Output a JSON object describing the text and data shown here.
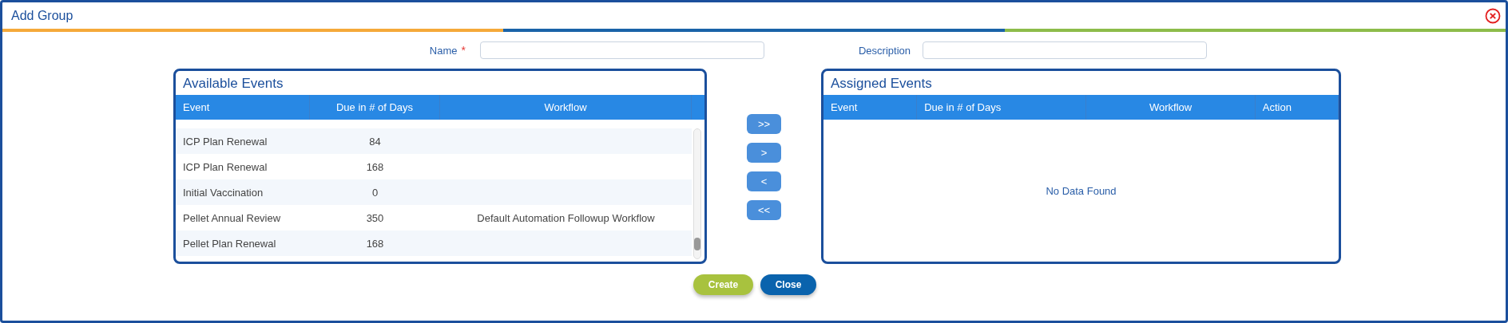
{
  "window": {
    "title": "Add Group"
  },
  "form": {
    "name": {
      "label": "Name",
      "required_mark": "*"
    },
    "description": {
      "label": "Description"
    }
  },
  "available": {
    "title": "Available Events",
    "columns": [
      "Event",
      "Due in # of Days",
      "Workflow"
    ],
    "rows": [
      {
        "event": "ICP Plan Renewal",
        "due": "84"
      },
      {
        "event": "ICP Plan Renewal",
        "due": "168"
      },
      {
        "event": "Initial Vaccination",
        "due": "0"
      },
      {
        "event": "Pellet Annual Review",
        "due": "350",
        "workflow": "Default Automation Followup Workflow"
      },
      {
        "event": "Pellet Plan Renewal",
        "due": "168"
      }
    ]
  },
  "transfer_buttons": [
    ">>",
    ">",
    "<",
    "<<"
  ],
  "assigned": {
    "title": "Assigned Events",
    "columns": [
      "Event",
      "Due in # of Days",
      "Workflow",
      "Action"
    ],
    "empty_message": "No Data Found"
  },
  "buttons": [
    {
      "label": "Create",
      "kind": "primary"
    },
    {
      "label": "Close",
      "kind": "secondary"
    }
  ]
}
